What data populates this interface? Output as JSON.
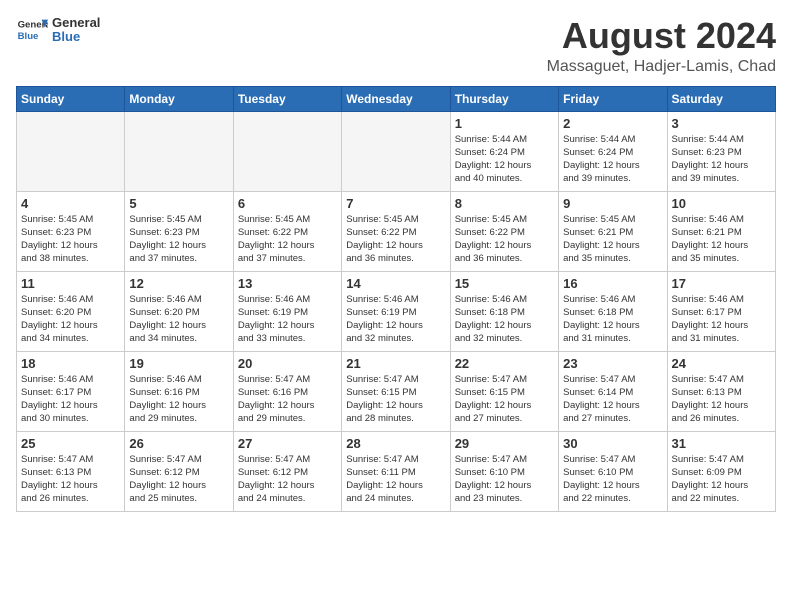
{
  "logo": {
    "general": "General",
    "blue": "Blue"
  },
  "title": "August 2024",
  "subtitle": "Massaguet, Hadjer-Lamis, Chad",
  "weekdays": [
    "Sunday",
    "Monday",
    "Tuesday",
    "Wednesday",
    "Thursday",
    "Friday",
    "Saturday"
  ],
  "weeks": [
    [
      {
        "day": "",
        "info": ""
      },
      {
        "day": "",
        "info": ""
      },
      {
        "day": "",
        "info": ""
      },
      {
        "day": "",
        "info": ""
      },
      {
        "day": "1",
        "info": "Sunrise: 5:44 AM\nSunset: 6:24 PM\nDaylight: 12 hours\nand 40 minutes."
      },
      {
        "day": "2",
        "info": "Sunrise: 5:44 AM\nSunset: 6:24 PM\nDaylight: 12 hours\nand 39 minutes."
      },
      {
        "day": "3",
        "info": "Sunrise: 5:44 AM\nSunset: 6:23 PM\nDaylight: 12 hours\nand 39 minutes."
      }
    ],
    [
      {
        "day": "4",
        "info": "Sunrise: 5:45 AM\nSunset: 6:23 PM\nDaylight: 12 hours\nand 38 minutes."
      },
      {
        "day": "5",
        "info": "Sunrise: 5:45 AM\nSunset: 6:23 PM\nDaylight: 12 hours\nand 37 minutes."
      },
      {
        "day": "6",
        "info": "Sunrise: 5:45 AM\nSunset: 6:22 PM\nDaylight: 12 hours\nand 37 minutes."
      },
      {
        "day": "7",
        "info": "Sunrise: 5:45 AM\nSunset: 6:22 PM\nDaylight: 12 hours\nand 36 minutes."
      },
      {
        "day": "8",
        "info": "Sunrise: 5:45 AM\nSunset: 6:22 PM\nDaylight: 12 hours\nand 36 minutes."
      },
      {
        "day": "9",
        "info": "Sunrise: 5:45 AM\nSunset: 6:21 PM\nDaylight: 12 hours\nand 35 minutes."
      },
      {
        "day": "10",
        "info": "Sunrise: 5:46 AM\nSunset: 6:21 PM\nDaylight: 12 hours\nand 35 minutes."
      }
    ],
    [
      {
        "day": "11",
        "info": "Sunrise: 5:46 AM\nSunset: 6:20 PM\nDaylight: 12 hours\nand 34 minutes."
      },
      {
        "day": "12",
        "info": "Sunrise: 5:46 AM\nSunset: 6:20 PM\nDaylight: 12 hours\nand 34 minutes."
      },
      {
        "day": "13",
        "info": "Sunrise: 5:46 AM\nSunset: 6:19 PM\nDaylight: 12 hours\nand 33 minutes."
      },
      {
        "day": "14",
        "info": "Sunrise: 5:46 AM\nSunset: 6:19 PM\nDaylight: 12 hours\nand 32 minutes."
      },
      {
        "day": "15",
        "info": "Sunrise: 5:46 AM\nSunset: 6:18 PM\nDaylight: 12 hours\nand 32 minutes."
      },
      {
        "day": "16",
        "info": "Sunrise: 5:46 AM\nSunset: 6:18 PM\nDaylight: 12 hours\nand 31 minutes."
      },
      {
        "day": "17",
        "info": "Sunrise: 5:46 AM\nSunset: 6:17 PM\nDaylight: 12 hours\nand 31 minutes."
      }
    ],
    [
      {
        "day": "18",
        "info": "Sunrise: 5:46 AM\nSunset: 6:17 PM\nDaylight: 12 hours\nand 30 minutes."
      },
      {
        "day": "19",
        "info": "Sunrise: 5:46 AM\nSunset: 6:16 PM\nDaylight: 12 hours\nand 29 minutes."
      },
      {
        "day": "20",
        "info": "Sunrise: 5:47 AM\nSunset: 6:16 PM\nDaylight: 12 hours\nand 29 minutes."
      },
      {
        "day": "21",
        "info": "Sunrise: 5:47 AM\nSunset: 6:15 PM\nDaylight: 12 hours\nand 28 minutes."
      },
      {
        "day": "22",
        "info": "Sunrise: 5:47 AM\nSunset: 6:15 PM\nDaylight: 12 hours\nand 27 minutes."
      },
      {
        "day": "23",
        "info": "Sunrise: 5:47 AM\nSunset: 6:14 PM\nDaylight: 12 hours\nand 27 minutes."
      },
      {
        "day": "24",
        "info": "Sunrise: 5:47 AM\nSunset: 6:13 PM\nDaylight: 12 hours\nand 26 minutes."
      }
    ],
    [
      {
        "day": "25",
        "info": "Sunrise: 5:47 AM\nSunset: 6:13 PM\nDaylight: 12 hours\nand 26 minutes."
      },
      {
        "day": "26",
        "info": "Sunrise: 5:47 AM\nSunset: 6:12 PM\nDaylight: 12 hours\nand 25 minutes."
      },
      {
        "day": "27",
        "info": "Sunrise: 5:47 AM\nSunset: 6:12 PM\nDaylight: 12 hours\nand 24 minutes."
      },
      {
        "day": "28",
        "info": "Sunrise: 5:47 AM\nSunset: 6:11 PM\nDaylight: 12 hours\nand 24 minutes."
      },
      {
        "day": "29",
        "info": "Sunrise: 5:47 AM\nSunset: 6:10 PM\nDaylight: 12 hours\nand 23 minutes."
      },
      {
        "day": "30",
        "info": "Sunrise: 5:47 AM\nSunset: 6:10 PM\nDaylight: 12 hours\nand 22 minutes."
      },
      {
        "day": "31",
        "info": "Sunrise: 5:47 AM\nSunset: 6:09 PM\nDaylight: 12 hours\nand 22 minutes."
      }
    ]
  ]
}
